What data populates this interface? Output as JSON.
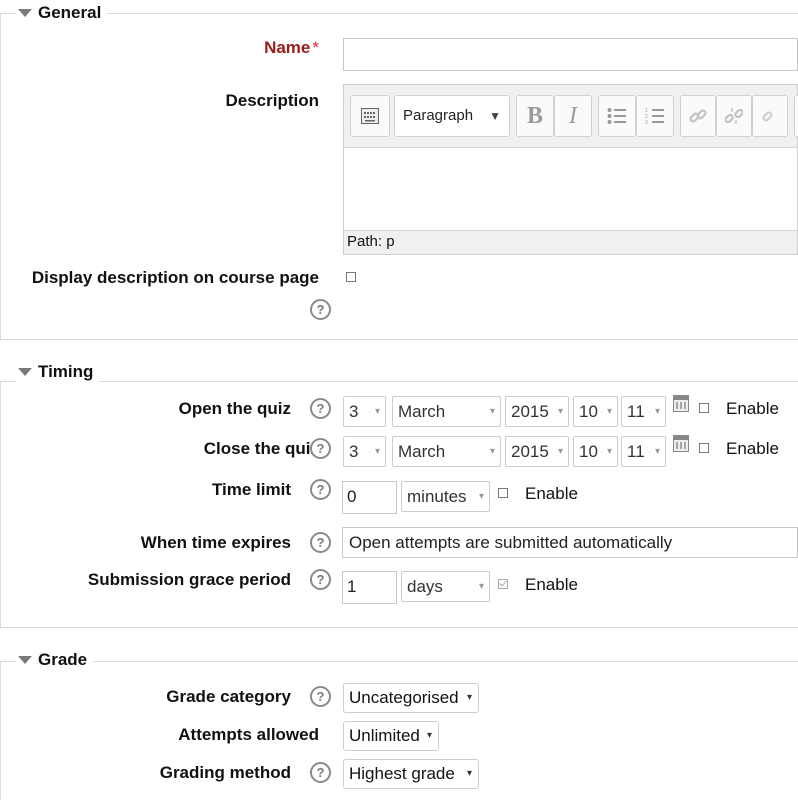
{
  "sections": {
    "general": {
      "legend": "General",
      "name_label": "Name",
      "required_mark": "*",
      "name_value": "",
      "description_label": "Description",
      "editor": {
        "format": "Paragraph",
        "bold": "B",
        "italic": "I",
        "path": "Path: p"
      },
      "display_desc_label": "Display description on course page",
      "display_desc_checked": false
    },
    "timing": {
      "legend": "Timing",
      "open": {
        "label": "Open the quiz",
        "day": "3",
        "month": "March",
        "year": "2015",
        "hour": "10",
        "minute": "11",
        "enable": "Enable"
      },
      "close": {
        "label": "Close the quiz",
        "day": "3",
        "month": "March",
        "year": "2015",
        "hour": "10",
        "minute": "11",
        "enable": "Enable"
      },
      "time_limit": {
        "label": "Time limit",
        "value": "0",
        "unit": "minutes",
        "enable": "Enable"
      },
      "expires": {
        "label": "When time expires",
        "value": "Open attempts are submitted automatically"
      },
      "grace": {
        "label": "Submission grace period",
        "value": "1",
        "unit": "days",
        "enable": "Enable",
        "checked": true
      }
    },
    "grade": {
      "legend": "Grade",
      "category": {
        "label": "Grade category",
        "value": "Uncategorised"
      },
      "attempts": {
        "label": "Attempts allowed",
        "value": "Unlimited"
      },
      "method": {
        "label": "Grading method",
        "value": "Highest grade"
      }
    }
  },
  "icons": {
    "help": "?",
    "dropdown": "▾"
  }
}
